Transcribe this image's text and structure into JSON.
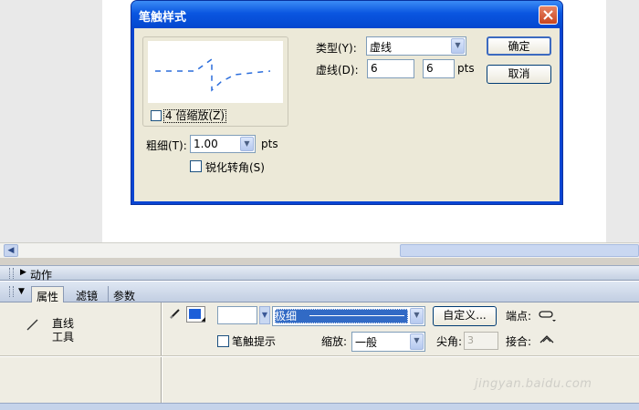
{
  "dialog": {
    "title": "笔触样式",
    "zoom_label": "4 倍缩放(Z)",
    "thickness_label": "粗细(T):",
    "thickness_value": "1.00",
    "thickness_unit": "pts",
    "sharpen_label": "锐化转角(S)",
    "type_label": "类型(Y):",
    "type_value": "虚线",
    "dash_label": "虚线(D):",
    "dash_length": "6",
    "dash_gap": "6",
    "dash_unit": "pts",
    "ok_label": "确定",
    "cancel_label": "取消"
  },
  "panels": {
    "actions_label": "动作",
    "tabs": [
      "属性",
      "滤镜",
      "参数"
    ]
  },
  "properties": {
    "tool_name": "直线工具",
    "stroke_color": "#1d5fd8",
    "stroke_style_value": "极细",
    "custom_button": "自定义...",
    "cap_label": "端点:",
    "hints_label": "笔触提示",
    "scale_label": "缩放:",
    "scale_value": "一般",
    "miter_label": "尖角:",
    "miter_value": "3",
    "join_label": "接合:"
  },
  "watermark": "jingyan.baidu.com"
}
